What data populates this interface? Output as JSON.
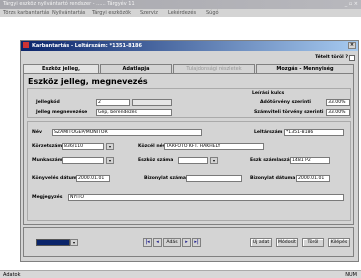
{
  "app": {
    "title": "Tárgyi eszköz nyilvántartó rendszer - ......  Tárgyév 11"
  },
  "menu": [
    {
      "label": "Törzs karbantartás"
    },
    {
      "label": "Nyilvántartás"
    },
    {
      "label": "Tárgyi eszközök"
    },
    {
      "label": "Szerviz"
    },
    {
      "label": "Lekérdezés"
    },
    {
      "label": "Súgó"
    }
  ],
  "window": {
    "title": "Karbantartás - Leltárszám: *1351-8186",
    "toggle_label": "Tételt töröl ?"
  },
  "tabs": [
    {
      "label": "Eszköz jelleg, megnevezés"
    },
    {
      "label": "Adatlapja"
    },
    {
      "label": "Tulajdonsági részletek"
    },
    {
      "label": "Mozgás - Mennyiség"
    }
  ],
  "section": {
    "title": "Eszköz jelleg, megnevezés"
  },
  "jelleg": {
    "jellegkod_label": "Jellegkód",
    "jellegkod_value": "2",
    "jellegmeg_label": "Jelleg megnevezése",
    "jellegmeg_value": "Gép, berendezés"
  },
  "leiras": {
    "header": "Leírási kulcs",
    "szamviteli_label": "Adótörvény szerinti",
    "szamviteli_value": "33.00%",
    "szamv2_label": "Számviteli törvény szerinti",
    "szamv2_value": "33.00%"
  },
  "details": {
    "nev_label": "Név",
    "nev_value": "SZÁMÍTÓGÉP/MONITOR",
    "leltar_label": "Leltárszám",
    "leltar_value": "*1351-8186",
    "korzet_label": "Körzetszám",
    "korzet_value": "836/110",
    "kozcel_label": "Közcél név",
    "kozcel_value": "TÁRFOTÓ KFT. HAKHELY",
    "munkaszam_label": "Munkaszám",
    "munkaszam_value": "",
    "eszkoz_label": "Eszköz száma",
    "eszkoz_value": "",
    "eszk_szam_label": "Eszk számlaszám",
    "eszk_szam_value": "1481 P2",
    "konyveles_label": "Könyvelés dátuma",
    "konyveles_value": "2000.01.01",
    "bizonylat_label": "Bizonylat száma",
    "bizonylat_value": "",
    "biz_datum_label": "Bizonylat dátuma",
    "biz_datum_value": "2000.01.01",
    "megj_label": "Megjegyzés",
    "megj_value": "NYITÓ"
  },
  "nav": {
    "page_label": "Adás"
  },
  "buttons": {
    "new": "Új adat",
    "edit": "Módosít",
    "delete": "Töröl",
    "exit": "Kilépés"
  },
  "status": {
    "left": "Adatok",
    "right": "NUM"
  },
  "colors": {
    "title_start": "#0a246a",
    "title_end": "#a6caf0",
    "face": "#d4d4d4"
  }
}
